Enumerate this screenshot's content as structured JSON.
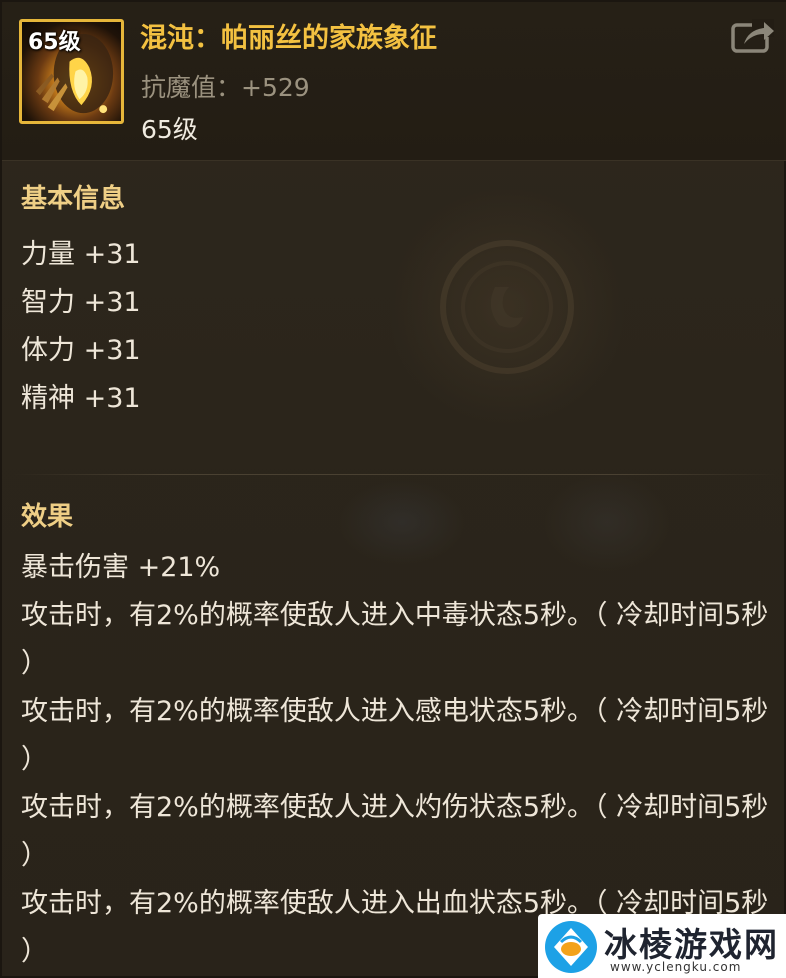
{
  "item": {
    "level_badge": "65级",
    "title": "混沌：帕丽丝的家族象征",
    "resist_label": "抗魔值：",
    "resist_value": "+529",
    "required_level": "65级",
    "title_color": "#f3c141",
    "icon": "item-icon"
  },
  "basic": {
    "heading": "基本信息",
    "stats": [
      "力量 +31",
      "智力 +31",
      "体力 +31",
      "精神 +31"
    ]
  },
  "effects": {
    "heading": "效果",
    "lines": [
      "暴击伤害 +21%",
      "攻击时，有2%的概率使敌人进入中毒状态5秒。（ 冷却时间5秒 ）",
      "攻击时，有2%的概率使敌人进入感电状态5秒。（ 冷却时间5秒 ）",
      "攻击时，有2%的概率使敌人进入灼伤状态5秒。（ 冷却时间5秒 ）",
      "攻击时，有2%的概率使敌人进入出血状态5秒。（ 冷却时间5秒 ）"
    ]
  },
  "actions": {
    "share_icon": "share-icon"
  },
  "watermark": {
    "name": "冰棱游戏网",
    "url": "www.yclengku.com"
  }
}
